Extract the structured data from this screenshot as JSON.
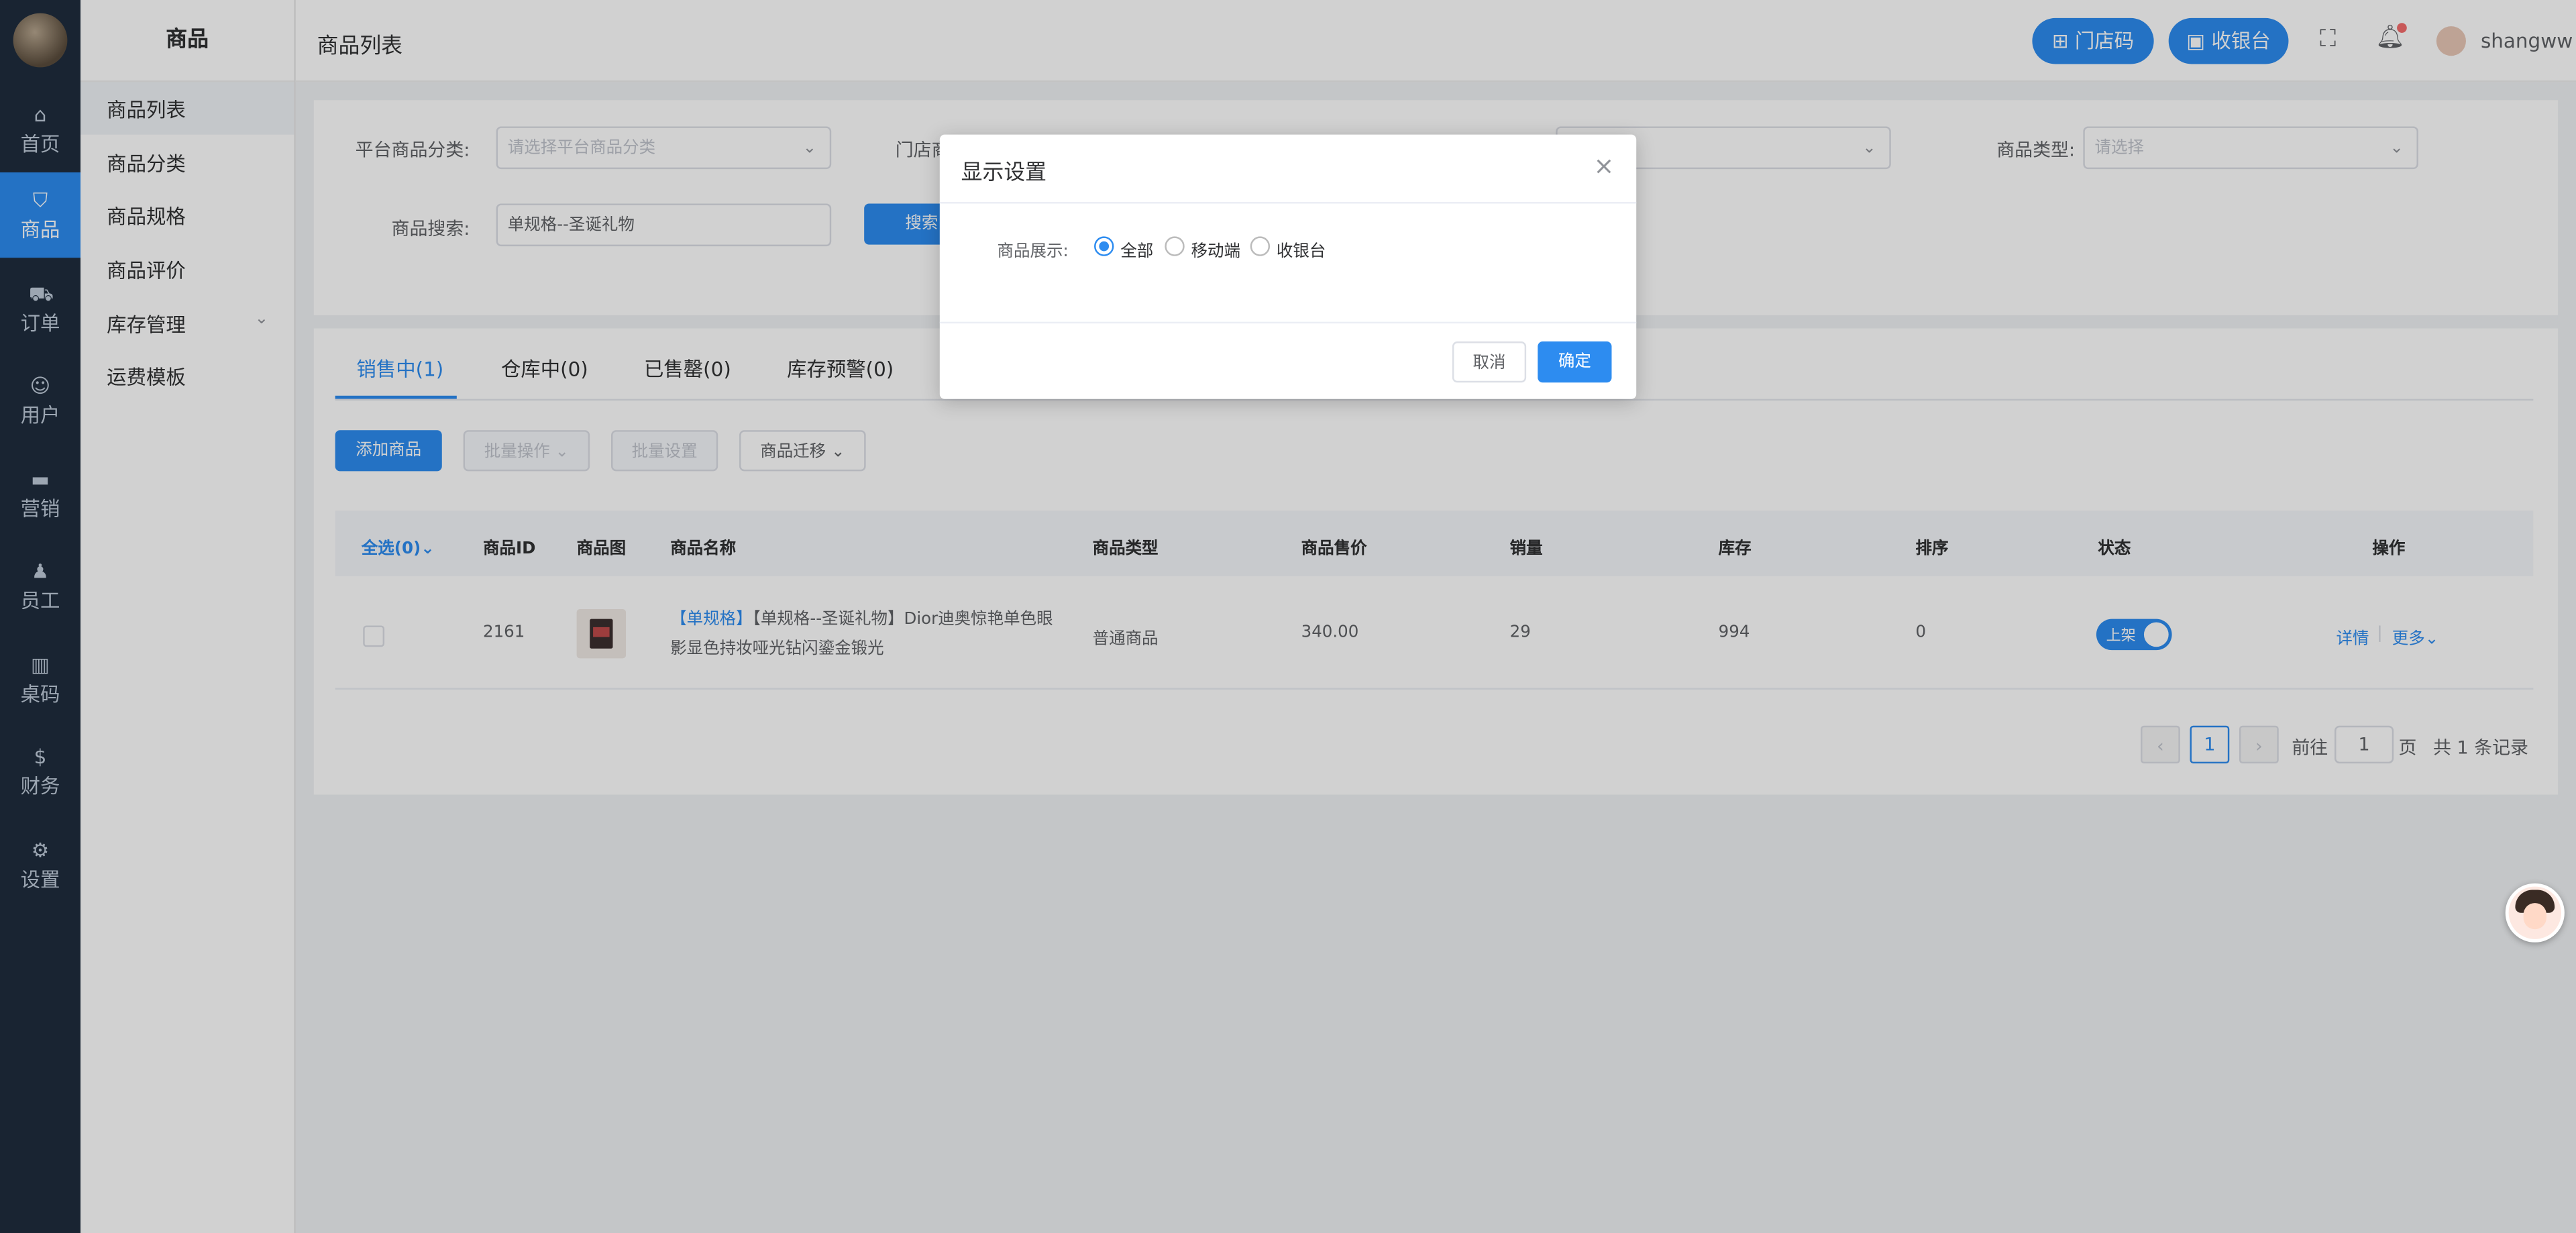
{
  "rail": {
    "items": [
      {
        "label": "首页",
        "icon": "home-icon"
      },
      {
        "label": "商品",
        "icon": "basket-icon"
      },
      {
        "label": "订单",
        "icon": "cart-icon"
      },
      {
        "label": "用户",
        "icon": "users-icon"
      },
      {
        "label": "营销",
        "icon": "gift-icon"
      },
      {
        "label": "员工",
        "icon": "person-icon"
      },
      {
        "label": "桌码",
        "icon": "table-code-icon"
      },
      {
        "label": "财务",
        "icon": "dollar-icon"
      },
      {
        "label": "设置",
        "icon": "gear-icon"
      }
    ],
    "active_index": 1,
    "accent": "#2d8cf0"
  },
  "submenu": {
    "title": "商品",
    "items": [
      "商品列表",
      "商品分类",
      "商品规格",
      "商品评价",
      "库存管理",
      "运费模板"
    ]
  },
  "header": {
    "breadcrumb": "商品列表",
    "store_code": "门店码",
    "cashier": "收银台",
    "username": "shangww"
  },
  "filters": {
    "platform_category_label": "平台商品分类:",
    "platform_category_placeholder": "请选择平台商品分类",
    "store_category_label": "门店商",
    "type_label": "商品类型:",
    "type_placeholder": "请选择",
    "search_label": "商品搜索:",
    "search_value": "单规格--圣诞礼物",
    "search_button": "搜索"
  },
  "tabs": [
    "销售中(1)",
    "仓库中(0)",
    "已售罄(0)",
    "库存预警(0)"
  ],
  "actions": {
    "add": "添加商品",
    "batch_ops": "批量操作",
    "batch_settings": "批量设置",
    "migrate": "商品迁移"
  },
  "table": {
    "headers": [
      "全选(0)",
      "商品ID",
      "商品图",
      "商品名称",
      "商品类型",
      "商品售价",
      "销量",
      "库存",
      "排序",
      "状态",
      "操作"
    ],
    "rows": [
      {
        "id": "2161",
        "name_tag": "【单规格】",
        "name_line1": "【单规格--圣诞礼物】Dior迪奥惊艳单色眼",
        "name_line2": "影显色持妆哑光钻闪鎏金锻光",
        "type": "普通商品",
        "price": "340.00",
        "sales": "29",
        "stock": "994",
        "sort": "0",
        "status": "上架",
        "status_on": true,
        "detail": "详情",
        "more": "更多"
      }
    ]
  },
  "pagination": {
    "current": "1",
    "goto_label": "前往",
    "goto_value": "1",
    "page_unit": "页",
    "total": "共 1 条记录"
  },
  "dialog": {
    "title": "显示设置",
    "field_label": "商品展示:",
    "options": [
      "全部",
      "移动端",
      "收银台"
    ],
    "selected_index": 0,
    "cancel": "取消",
    "confirm": "确定"
  }
}
